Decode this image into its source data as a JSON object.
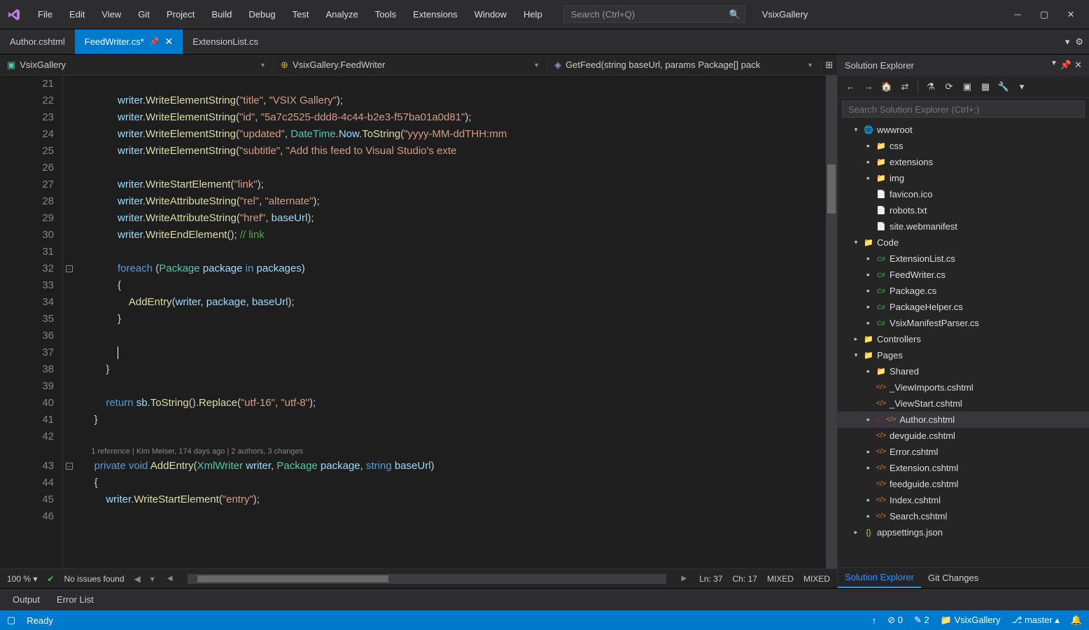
{
  "menu": [
    "File",
    "Edit",
    "View",
    "Git",
    "Project",
    "Build",
    "Debug",
    "Test",
    "Analyze",
    "Tools",
    "Extensions",
    "Window",
    "Help"
  ],
  "search_placeholder": "Search (Ctrl+Q)",
  "solution_name": "VsixGallery",
  "tabs": [
    {
      "label": "Author.cshtml",
      "active": false,
      "pinned": false
    },
    {
      "label": "FeedWriter.cs*",
      "active": true,
      "pinned": true
    },
    {
      "label": "ExtensionList.cs",
      "active": false,
      "pinned": false
    }
  ],
  "nav": {
    "project": "VsixGallery",
    "class": "VsixGallery.FeedWriter",
    "member": "GetFeed(string baseUrl, params Package[] pack"
  },
  "code_start_line": 21,
  "codelens": "1 reference | Kim Meiser, 174 days ago | 2 authors, 3 changes",
  "zoom": "100 %",
  "issues": "No issues found",
  "cursor_line": "Ln: 37",
  "cursor_col": "Ch: 17",
  "mixed1": "MIXED",
  "mixed2": "MIXED",
  "panel_title": "Solution Explorer",
  "panel_search_placeholder": "Search Solution Explorer (Ctrl+;)",
  "tree": [
    {
      "depth": 0,
      "exp": "▾",
      "icon": "globe",
      "label": "wwwroot"
    },
    {
      "depth": 1,
      "exp": "▸",
      "icon": "folder",
      "label": "css"
    },
    {
      "depth": 1,
      "exp": "▸",
      "icon": "folder",
      "label": "extensions"
    },
    {
      "depth": 1,
      "exp": "▸",
      "icon": "folder",
      "label": "img"
    },
    {
      "depth": 1,
      "exp": "",
      "icon": "file",
      "label": "favicon.ico"
    },
    {
      "depth": 1,
      "exp": "",
      "icon": "file",
      "label": "robots.txt"
    },
    {
      "depth": 1,
      "exp": "",
      "icon": "file",
      "label": "site.webmanifest"
    },
    {
      "depth": 0,
      "exp": "▾",
      "icon": "folder",
      "label": "Code"
    },
    {
      "depth": 1,
      "exp": "▸",
      "icon": "cs",
      "label": "ExtensionList.cs"
    },
    {
      "depth": 1,
      "exp": "▸",
      "icon": "cs",
      "label": "FeedWriter.cs"
    },
    {
      "depth": 1,
      "exp": "▸",
      "icon": "cs",
      "label": "Package.cs"
    },
    {
      "depth": 1,
      "exp": "▸",
      "icon": "cs",
      "label": "PackageHelper.cs"
    },
    {
      "depth": 1,
      "exp": "▸",
      "icon": "cs",
      "label": "VsixManifestParser.cs"
    },
    {
      "depth": 0,
      "exp": "▸",
      "icon": "folder",
      "label": "Controllers"
    },
    {
      "depth": 0,
      "exp": "▾",
      "icon": "folder",
      "label": "Pages"
    },
    {
      "depth": 1,
      "exp": "▸",
      "icon": "folder",
      "label": "Shared"
    },
    {
      "depth": 1,
      "exp": "",
      "icon": "cshtml",
      "label": "_ViewImports.cshtml"
    },
    {
      "depth": 1,
      "exp": "",
      "icon": "cshtml",
      "label": "_ViewStart.cshtml"
    },
    {
      "depth": 1,
      "exp": "▸",
      "icon": "cshtml",
      "label": "Author.cshtml",
      "selected": true,
      "mark": true
    },
    {
      "depth": 1,
      "exp": "",
      "icon": "cshtml",
      "label": "devguide.cshtml"
    },
    {
      "depth": 1,
      "exp": "▸",
      "icon": "cshtml",
      "label": "Error.cshtml"
    },
    {
      "depth": 1,
      "exp": "▸",
      "icon": "cshtml",
      "label": "Extension.cshtml"
    },
    {
      "depth": 1,
      "exp": "",
      "icon": "cshtml",
      "label": "feedguide.cshtml"
    },
    {
      "depth": 1,
      "exp": "▸",
      "icon": "cshtml",
      "label": "Index.cshtml"
    },
    {
      "depth": 1,
      "exp": "▸",
      "icon": "cshtml",
      "label": "Search.cshtml"
    },
    {
      "depth": 0,
      "exp": "▸",
      "icon": "json",
      "label": "appsettings.json"
    }
  ],
  "panel_tabs": [
    "Solution Explorer",
    "Git Changes"
  ],
  "bottom_tabs": [
    "Output",
    "Error List"
  ],
  "status": {
    "ready": "Ready",
    "errors": "0",
    "warnings": "2",
    "repo": "VsixGallery",
    "branch": "master"
  }
}
